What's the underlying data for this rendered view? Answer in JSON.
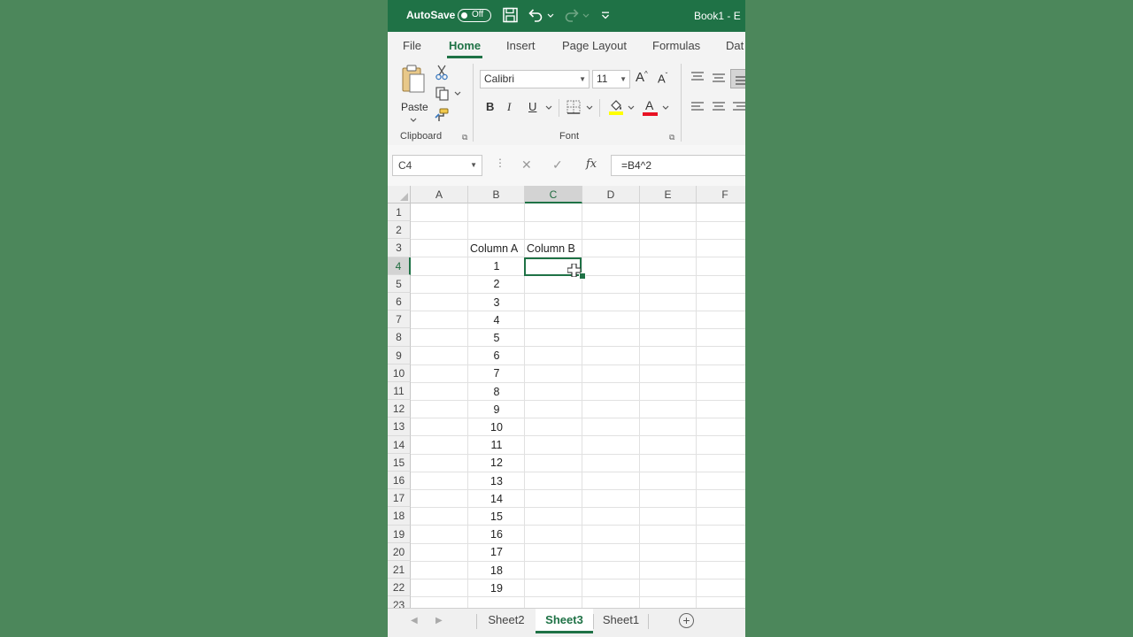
{
  "titlebar": {
    "autosave_label": "AutoSave",
    "autosave_state": "Off",
    "book_title": "Book1 - E"
  },
  "ribbon_tabs": [
    "File",
    "Home",
    "Insert",
    "Page Layout",
    "Formulas",
    "Dat"
  ],
  "active_tab": "Home",
  "clipboard": {
    "paste_label": "Paste",
    "group_label": "Clipboard"
  },
  "font": {
    "font_name": "Calibri",
    "font_size": "11",
    "bold": "B",
    "italic": "I",
    "underline": "U",
    "group_label": "Font",
    "grow_label": "A",
    "shrink_label": "A",
    "font_color_label": "A",
    "highlight_color": "#ffff00",
    "font_color": "#e81123"
  },
  "formula_bar": {
    "name_box": "C4",
    "cancel_symbol": "✕",
    "enter_symbol": "✓",
    "fx_label": "fx",
    "formula": "=B4^2"
  },
  "grid": {
    "columns": [
      "A",
      "B",
      "C",
      "D",
      "E",
      "F"
    ],
    "selected_column": "C",
    "rows": [
      "1",
      "2",
      "3",
      "4",
      "5",
      "6",
      "7",
      "8",
      "9",
      "10",
      "11",
      "12",
      "13",
      "14",
      "15",
      "16",
      "17",
      "18",
      "19",
      "20",
      "21",
      "22",
      "23"
    ],
    "selected_row": "4",
    "headers": {
      "b3": "Column A",
      "c3": "Column B"
    },
    "column_b_values": [
      "1",
      "2",
      "3",
      "4",
      "5",
      "6",
      "7",
      "8",
      "9",
      "10",
      "11",
      "12",
      "13",
      "14",
      "15",
      "16",
      "17",
      "18",
      "19"
    ]
  },
  "sheets": [
    "Sheet2",
    "Sheet3",
    "Sheet1"
  ],
  "active_sheet": "Sheet3",
  "colors": {
    "excel_green": "#1f7246",
    "background_green": "#4c875b"
  }
}
